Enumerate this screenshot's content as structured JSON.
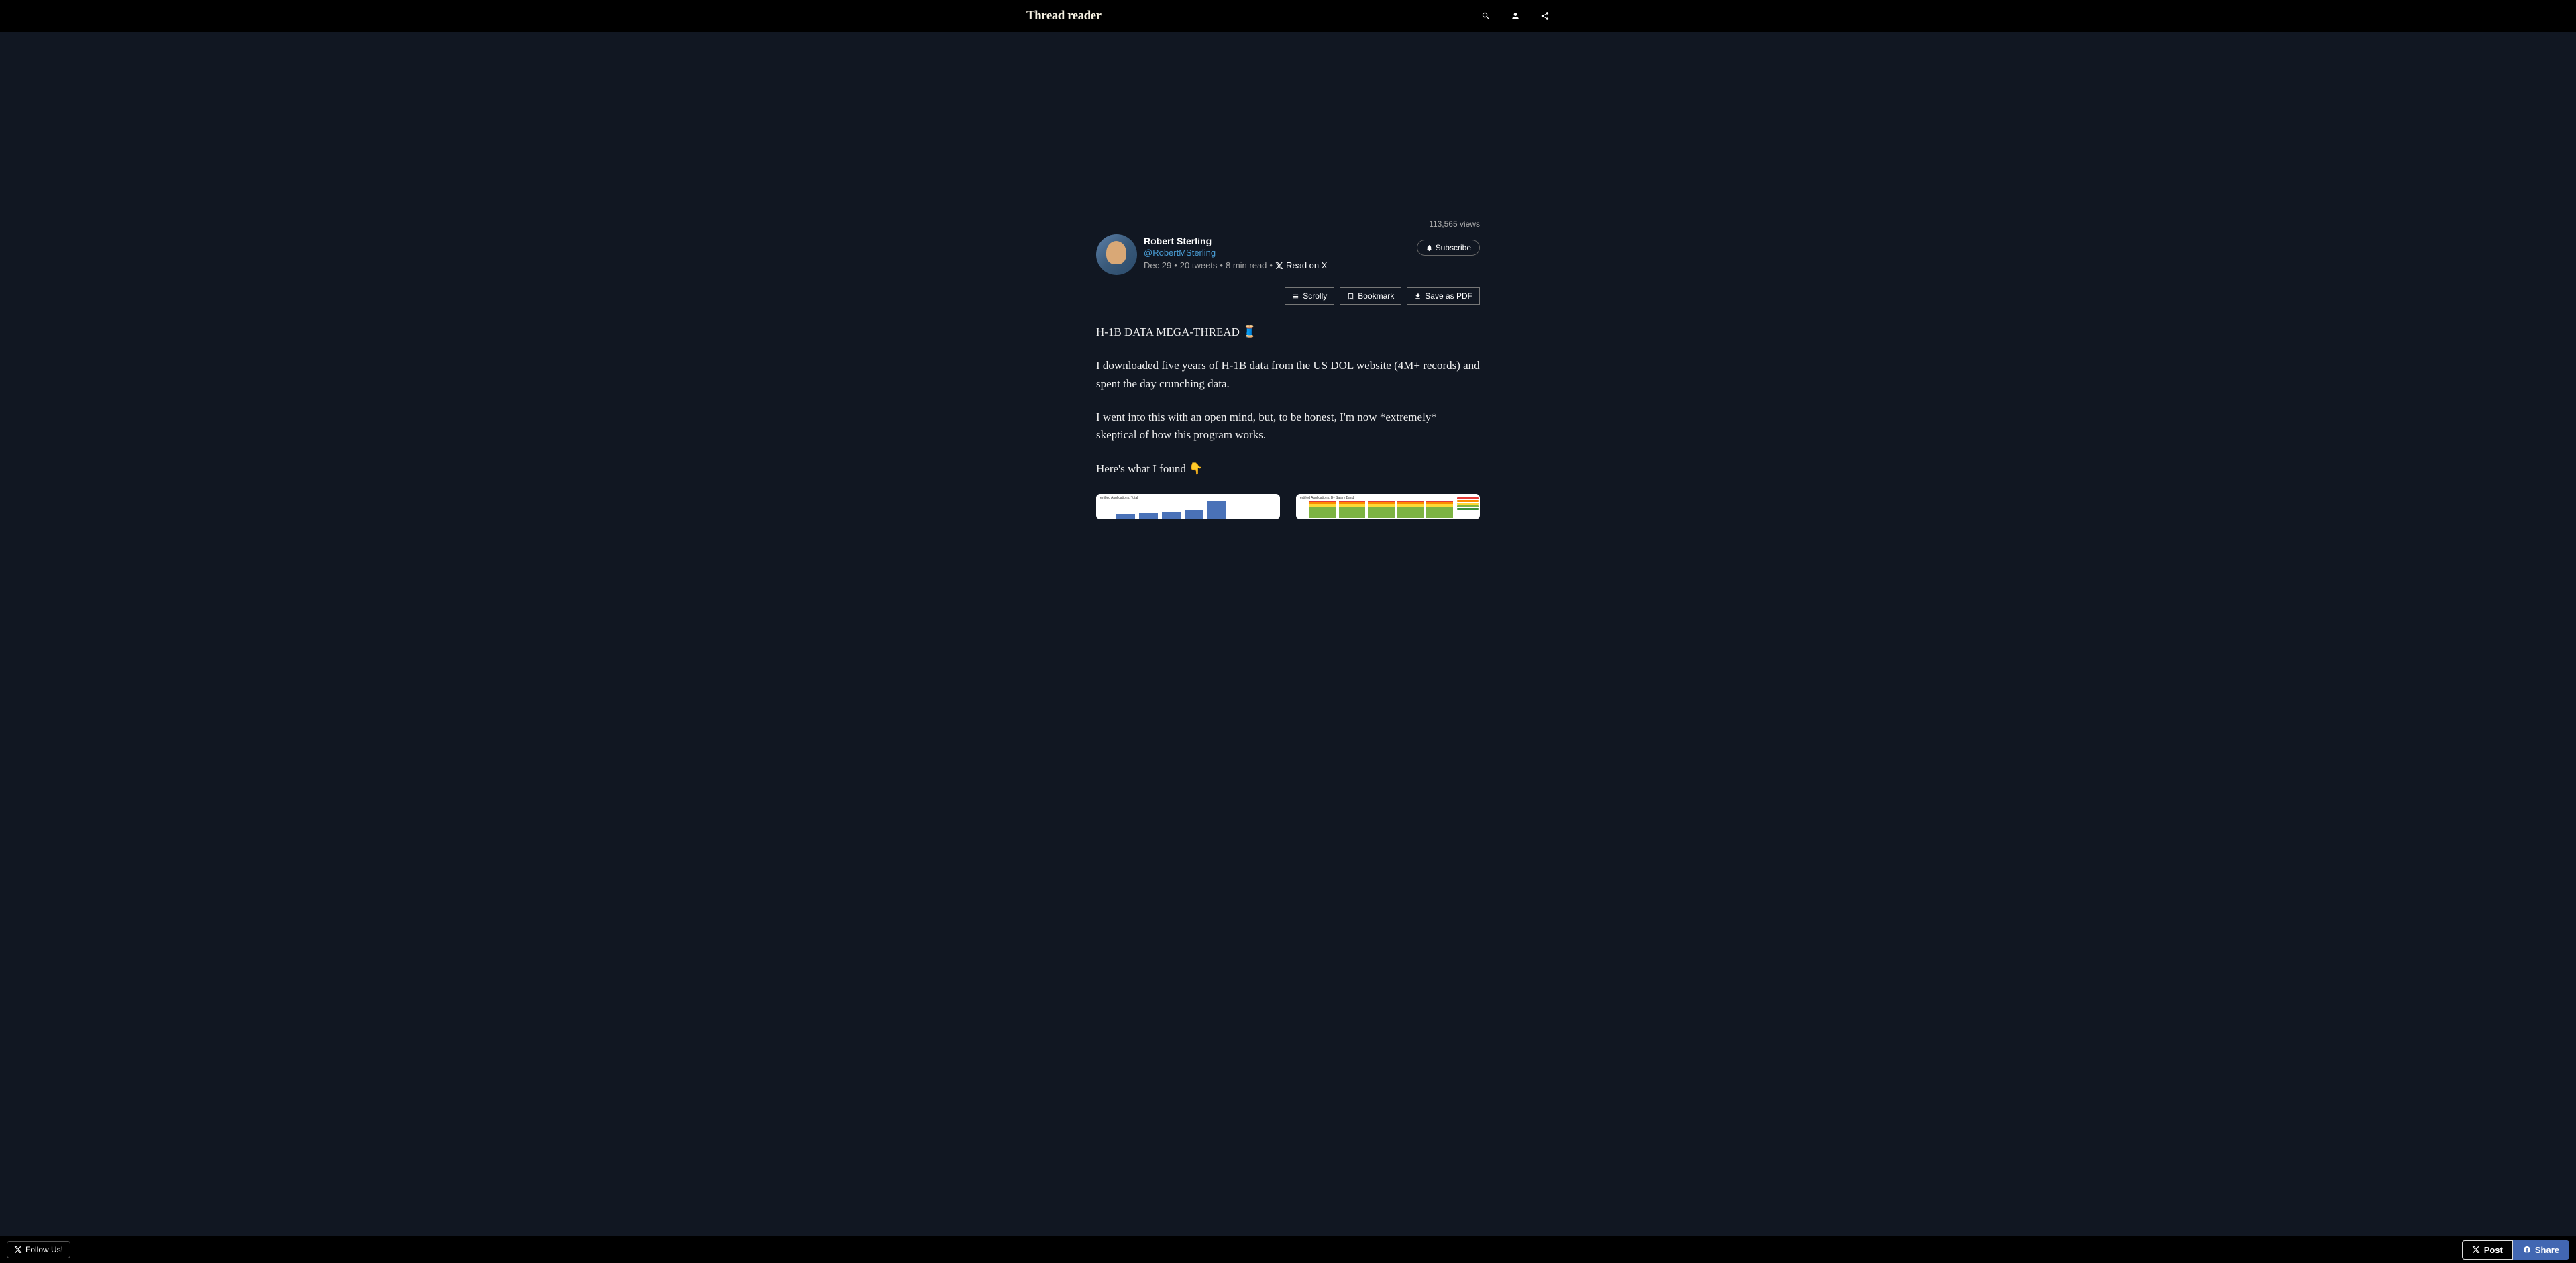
{
  "header": {
    "logo": "Thread reader"
  },
  "thread": {
    "views": "113,565 views",
    "author_name": "Robert Sterling",
    "author_handle": "@RobertMSterling",
    "meta": {
      "date": "Dec 29",
      "tweets": "20 tweets",
      "read_time": "8 min read",
      "read_on_x": "Read on X"
    },
    "subscribe": "Subscribe",
    "actions": {
      "scrolly": "Scrolly",
      "bookmark": "Bookmark",
      "save_pdf": "Save as PDF"
    },
    "body": {
      "p1": "H-1B DATA MEGA-THREAD 🧵",
      "p2": "I downloaded five years of H-1B data from the US DOL website (4M+ records) and spent the day crunching data.",
      "p3": "I went into this with an open mind, but, to be honest, I'm now *extremely* skeptical of how this program works.",
      "p4": "Here's what I found 👇"
    },
    "charts": {
      "chart1_title": "ertified Applications, Total",
      "chart2_title": "ertified Applications, By Salary Band"
    }
  },
  "footer": {
    "follow": "Follow Us!",
    "post": "Post",
    "share": "Share"
  }
}
